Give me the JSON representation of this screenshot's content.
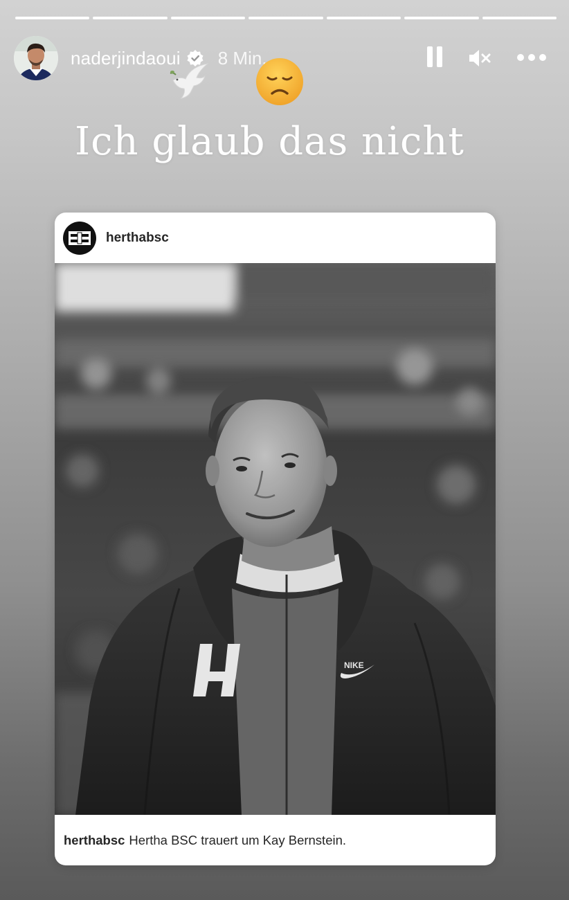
{
  "story": {
    "progress_segments": 7,
    "username": "naderjindaoui",
    "time": "8 Min.",
    "text": "Ich glaub das nicht",
    "stickers": [
      "dove-icon",
      "disappointed-face-emoji"
    ]
  },
  "controls": [
    "pause-icon",
    "mute-icon",
    "more-icon"
  ],
  "shared_post": {
    "username": "herthabsc",
    "caption_user": "herthabsc",
    "caption_text": "Hertha BSC trauert um Kay Bernstein.",
    "jacket_letter": "H",
    "jacket_brand": "NIKE"
  },
  "colors": {
    "text_dark": "#262626",
    "verified_blue": "#3897f0",
    "emoji_yellow": "#f5b63a"
  }
}
